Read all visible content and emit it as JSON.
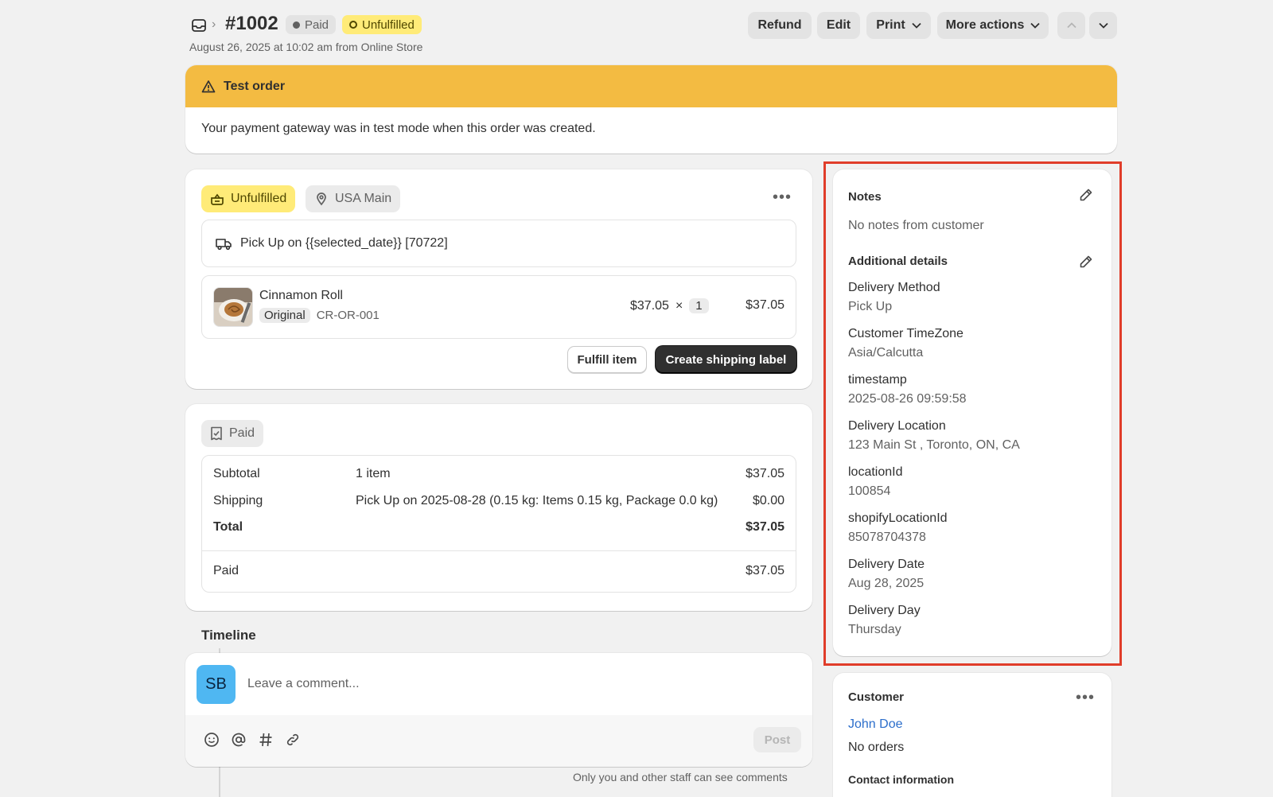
{
  "header": {
    "order_number": "#1002",
    "badge_paid": "Paid",
    "badge_unfulfilled": "Unfulfilled",
    "subtitle": "August 26, 2025 at 10:02 am from Online Store",
    "actions": {
      "refund": "Refund",
      "edit": "Edit",
      "print": "Print",
      "more": "More actions"
    }
  },
  "test_banner": {
    "title": "Test order",
    "body": "Your payment gateway was in test mode when this order was created."
  },
  "fulfillment": {
    "status": "Unfulfilled",
    "location": "USA Main",
    "delivery": "Pick Up on {{selected_date}} [70722]",
    "item": {
      "name": "Cinnamon Roll",
      "variant": "Original",
      "sku": "CR-OR-001",
      "price": "$37.05",
      "times": "×",
      "qty": "1",
      "total": "$37.05"
    },
    "fulfill_btn": "Fulfill item",
    "shipping_btn": "Create shipping label"
  },
  "payment": {
    "status": "Paid",
    "rows": [
      {
        "label": "Subtotal",
        "desc": "1 item",
        "amount": "$37.05"
      },
      {
        "label": "Shipping",
        "desc": "Pick Up on 2025-08-28 (0.15 kg: Items 0.15 kg, Package 0.0 kg)",
        "amount": "$0.00"
      },
      {
        "label": "Total",
        "desc": "",
        "amount": "$37.05"
      },
      {
        "label": "Paid",
        "desc": "",
        "amount": "$37.05"
      }
    ]
  },
  "timeline": {
    "title": "Timeline",
    "avatar": "SB",
    "placeholder": "Leave a comment...",
    "post": "Post",
    "note": "Only you and other staff can see comments"
  },
  "notes": {
    "title": "Notes",
    "empty": "No notes from customer",
    "additional_title": "Additional details",
    "details": [
      {
        "label": "Delivery Method",
        "value": "Pick Up"
      },
      {
        "label": "Customer TimeZone",
        "value": "Asia/Calcutta"
      },
      {
        "label": "timestamp",
        "value": "2025-08-26 09:59:58"
      },
      {
        "label": "Delivery Location",
        "value": "123 Main St , Toronto, ON, CA"
      },
      {
        "label": "locationId",
        "value": "100854"
      },
      {
        "label": "shopifyLocationId",
        "value": "85078704378"
      },
      {
        "label": "Delivery Date",
        "value": "Aug 28, 2025"
      },
      {
        "label": "Delivery Day",
        "value": "Thursday"
      }
    ]
  },
  "customer": {
    "title": "Customer",
    "name": "John Doe",
    "orders": "No orders",
    "contact_title": "Contact information"
  },
  "colors": {
    "warning_banner": "#f3bb42",
    "unfulfilled_badge": "#ffeb78",
    "highlight_box": "#e03d2a",
    "link": "#2c6ecb"
  }
}
